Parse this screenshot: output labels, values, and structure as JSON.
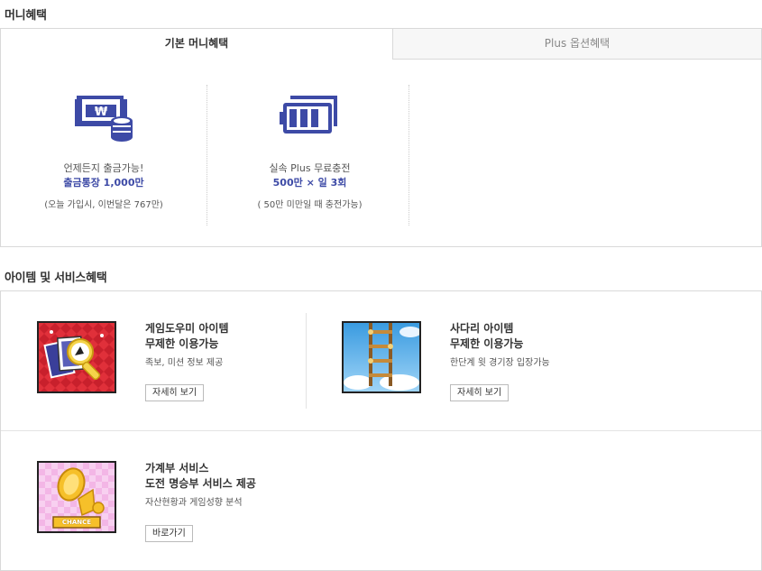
{
  "money_section": {
    "title": "머니혜택",
    "tabs": [
      {
        "label": "기본 머니혜택",
        "active": true
      },
      {
        "label": "Plus 옵션혜택",
        "active": false
      }
    ],
    "benefits": [
      {
        "icon": "wallet-coin-icon",
        "line1": "언제든지 출금가능!",
        "line2": "출금통장 1,000만",
        "line3": "(오늘 가입시, 이번달은 767만)"
      },
      {
        "icon": "battery-charge-icon",
        "line1": "실속 Plus 무료충전",
        "line2": "500만 × 일 3회",
        "line3": "( 50만 미만일 때 충전가능)"
      }
    ]
  },
  "service_section": {
    "title": "아이템 및 서비스혜택",
    "items": [
      {
        "icon": "magnifier-cards-icon",
        "title_lines": [
          "게임도우미 아이템",
          "무제한 이용가능"
        ],
        "desc": "족보, 미션 정보 제공",
        "button": "자세히 보기"
      },
      {
        "icon": "ladder-icon",
        "title_lines": [
          "사다리 아이템",
          "무제한 이용가능"
        ],
        "desc": "한단계 윗 경기장 입장가능",
        "button": "자세히 보기"
      },
      {
        "icon": "chance-coin-icon",
        "title_lines": [
          "가계부 서비스",
          "도전 명승부 서비스 제공"
        ],
        "desc": "자산현황과 게임성향 분석",
        "button": "바로가기",
        "badge": "CHANCE"
      }
    ]
  },
  "colors": {
    "accent": "#3d4aa6",
    "border": "#d9d9d9",
    "tab_inactive_bg": "#f7f7f7"
  }
}
